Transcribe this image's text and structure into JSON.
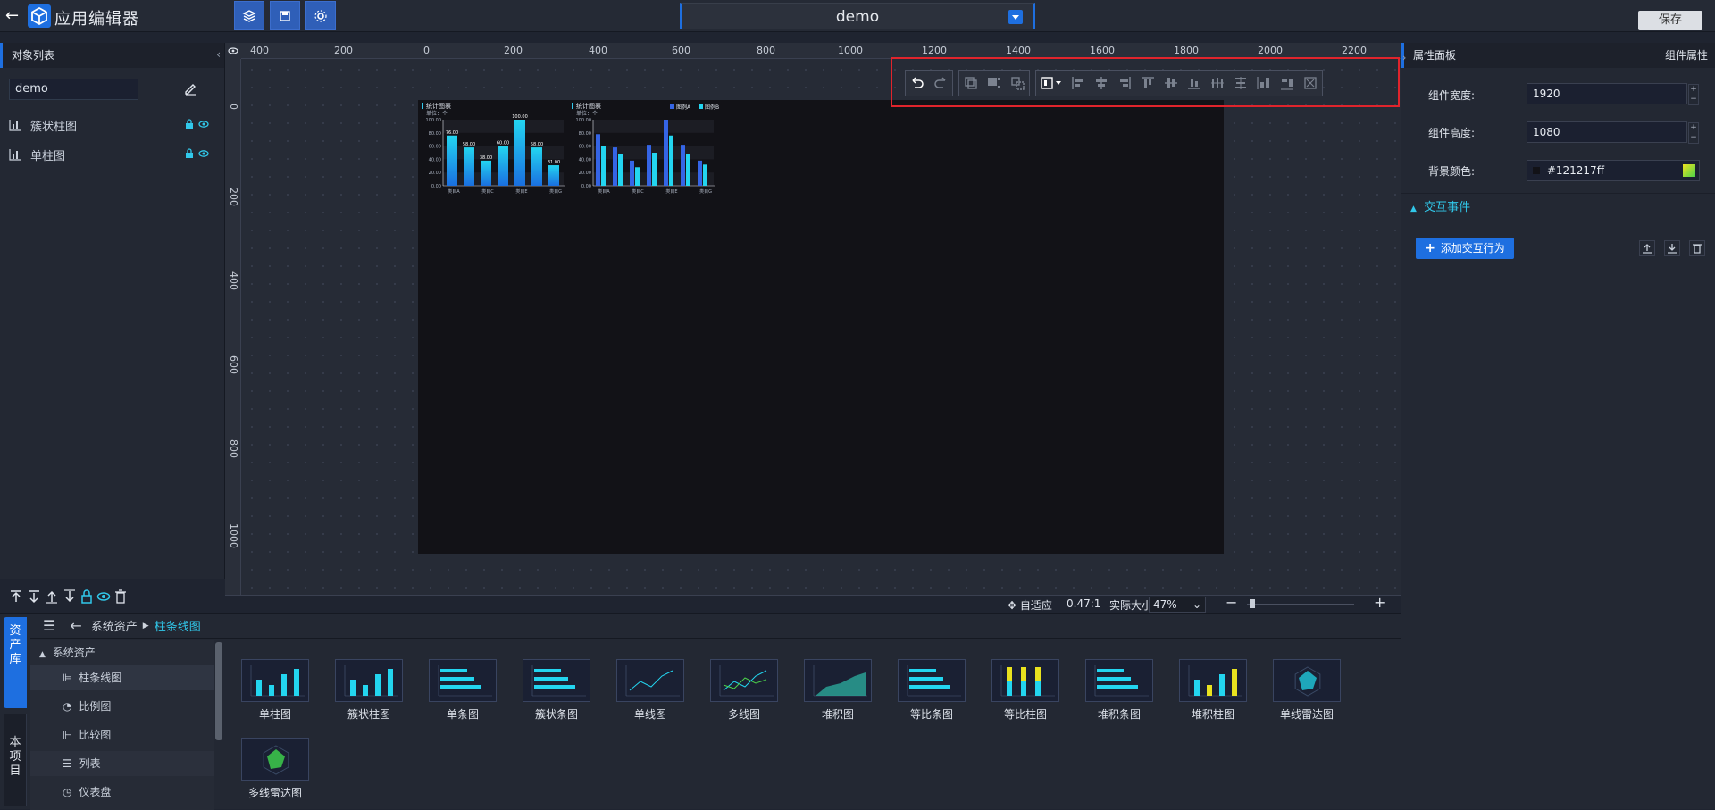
{
  "header": {
    "app_title": "应用编辑器",
    "project_name": "demo",
    "save_label": "保存"
  },
  "left_panel": {
    "title": "对象列表",
    "search_value": "demo",
    "objects": [
      {
        "label": "簇状柱图"
      },
      {
        "label": "单柱图"
      }
    ]
  },
  "ruler": {
    "h_labels": [
      "400",
      "200",
      "0",
      "200",
      "400",
      "600",
      "800",
      "1000",
      "1200",
      "1400",
      "1600",
      "1800",
      "2000",
      "2200"
    ],
    "v_labels": [
      "0",
      "200",
      "400",
      "600",
      "800",
      "1000"
    ]
  },
  "canvas_charts": {
    "chart1": {
      "title": "统计图表",
      "unit": "单位：个",
      "yticks": [
        "100.00",
        "80.00",
        "60.00",
        "40.00",
        "20.00",
        "0.00"
      ],
      "value_labels": [
        "76.00",
        "58.00",
        "38.00",
        "60.00",
        "100.00",
        "58.00",
        "31.00"
      ],
      "values": [
        76,
        58,
        38,
        60,
        100,
        58,
        31
      ],
      "xlabels": [
        "类目A",
        "类目C",
        "类目E",
        "类目G"
      ]
    },
    "chart2": {
      "title": "统计图表",
      "unit": "单位：个",
      "legend": [
        "图例A",
        "图例B"
      ],
      "yticks": [
        "100.00",
        "80.00",
        "60.00",
        "40.00",
        "20.00",
        "0.00"
      ],
      "series_a": [
        78,
        58,
        38,
        62,
        100,
        62,
        38
      ],
      "series_b": [
        60,
        48,
        28,
        50,
        76,
        48,
        32
      ],
      "xlabels": [
        "类目A",
        "类目C",
        "类目E",
        "类目G"
      ]
    }
  },
  "zoombar": {
    "fit_label": "自适应",
    "ratio": "0.47:1",
    "actual_label": "实际大小",
    "zoom_value": "47%"
  },
  "assets": {
    "tab_library": "资产库",
    "tab_project": "本项目",
    "breadcrumb_root": "系统资产",
    "breadcrumb_current": "柱条线图",
    "tree_root": "系统资产",
    "tree_items": [
      "柱条线图",
      "比例图",
      "比较图",
      "列表",
      "仪表盘"
    ],
    "cards": [
      "单柱图",
      "簇状柱图",
      "单条图",
      "簇状条图",
      "单线图",
      "多线图",
      "堆积图",
      "等比条图",
      "等比柱图",
      "堆积条图",
      "堆积柱图",
      "单线雷达图",
      "多线雷达图"
    ]
  },
  "right_panel": {
    "title": "属性面板",
    "subtitle": "组件属性",
    "width_label": "组件宽度:",
    "width_value": "1920",
    "height_label": "组件高度:",
    "height_value": "1080",
    "bg_label": "背景颜色:",
    "bg_value": "#121217ff",
    "events_label": "交互事件",
    "add_btn": "添加交互行为"
  },
  "colors": {
    "accent": "#1e6fe0",
    "stage_bg": "#121217",
    "highlight": "#e0242c",
    "bar_cyan": "#23d5f0",
    "bar_blue": "#3565e6"
  }
}
